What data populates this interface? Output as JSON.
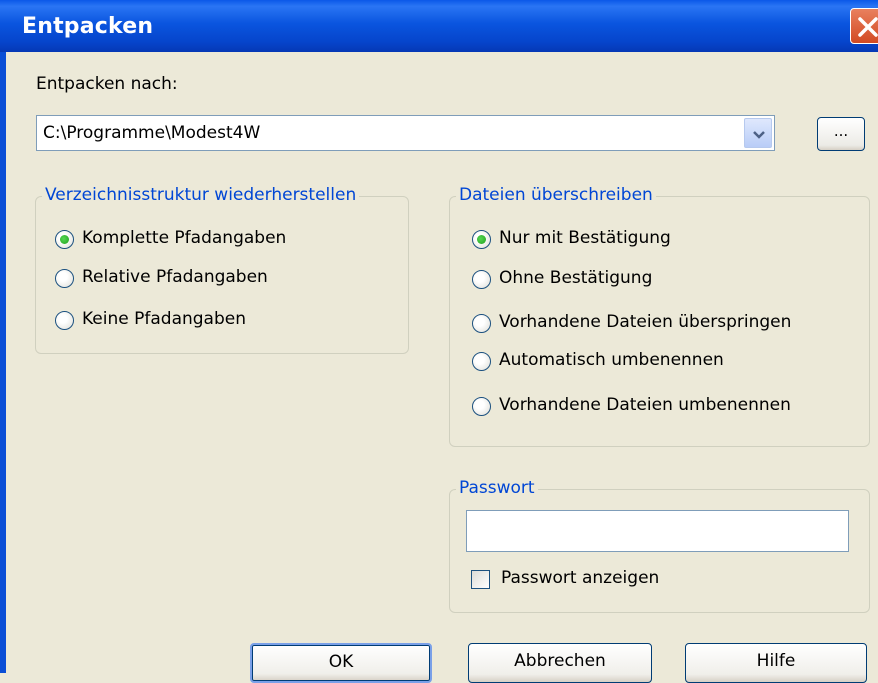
{
  "window": {
    "title": "Entpacken"
  },
  "icons": {
    "close": "close-icon",
    "dropdown": "chevron-down-icon"
  },
  "colors": {
    "titlebar": "#0a55df",
    "group_title": "#0046d5",
    "close_button": "#d24a23"
  },
  "extract_to": {
    "label": "Entpacken nach:",
    "value": "C:\\Programme\\Modest4W",
    "browse_label": "..."
  },
  "dir_structure": {
    "title": "Verzeichnisstruktur wiederherstellen",
    "options": [
      {
        "label": "Komplette Pfadangaben",
        "selected": true
      },
      {
        "label": "Relative Pfadangaben",
        "selected": false
      },
      {
        "label": "Keine Pfadangaben",
        "selected": false
      }
    ]
  },
  "overwrite": {
    "title": "Dateien überschreiben",
    "options": [
      {
        "label": "Nur mit Bestätigung",
        "selected": true
      },
      {
        "label": "Ohne Bestätigung",
        "selected": false
      },
      {
        "label": "Vorhandene Dateien überspringen",
        "selected": false
      },
      {
        "label": "Automatisch umbenennen",
        "selected": false
      },
      {
        "label": "Vorhandene Dateien umbenennen",
        "selected": false
      }
    ]
  },
  "password": {
    "title": "Passwort",
    "value": "",
    "show_label": "Passwort anzeigen",
    "show_checked": false
  },
  "buttons": {
    "ok": "OK",
    "cancel": "Abbrechen",
    "help": "Hilfe"
  }
}
